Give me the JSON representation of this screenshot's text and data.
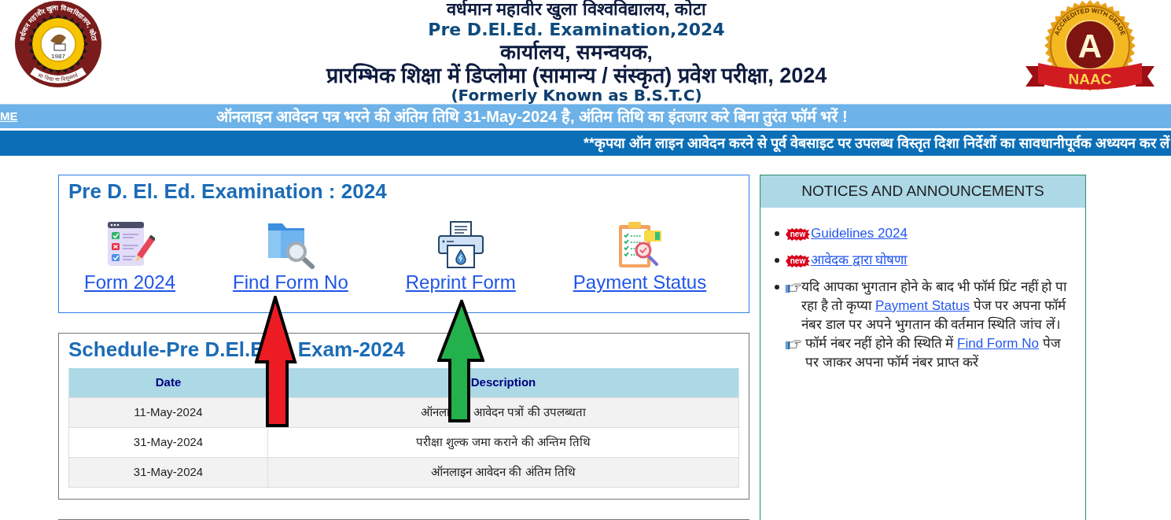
{
  "header": {
    "logo": {
      "ring_text": "वर्धमान महावीर खुला विश्वविद्यालय, कोटा",
      "year": "1987",
      "motto": "सा विद्या या विमुक्तये"
    },
    "title_lines": [
      {
        "kind": "university",
        "text": "वर्धमान महावीर खुला विश्वविद्यालय, कोटा"
      },
      {
        "kind": "exam",
        "text": "Pre D.El.Ed. Examination,2024"
      },
      {
        "kind": "office",
        "text": "कार्यालय, समन्वयक,"
      },
      {
        "kind": "course",
        "text": "प्रारम्भिक शिक्षा में डिप्लोमा (सामान्य / संस्कृत) प्रवेश परीक्षा, 2024"
      },
      {
        "kind": "former_name",
        "text": "(Formerly Known as B.S.T.C)"
      }
    ],
    "badge": {
      "ring_text": "ACCREDITED WITH GRADE",
      "grade": "A",
      "ribbon": "NAAC"
    }
  },
  "ticker": {
    "link": "ME",
    "text": "ऑनलाइन आवेदन पत्र भरने की अंतिम तिथि 31-May-2024 है, अंतिम तिथि का इंतजार करे बिना तुरंत फॉर्म भरें !"
  },
  "notice_bar": {
    "text": "**कृपया ऑन लाइन आवेदन करने से पूर्व वेबसाइट पर उपलब्ध विस्तृत दिशा निर्देशों का सावधानीपूर्वक अध्ययन कर लें"
  },
  "exam_card": {
    "title": "Pre D. El. Ed. Examination : 2024",
    "links": [
      "Form 2024",
      "Find Form No",
      "Reprint Form",
      "Payment Status"
    ]
  },
  "schedule": {
    "title_parts": [
      "Schedule-Pre D.El.E",
      "Exam-2024"
    ],
    "columns": [
      "Date",
      "Description"
    ],
    "rows": [
      {
        "date": "11-May-2024",
        "description_parts": [
          "ऑनला",
          "आवेदन पत्रों की उपलब्धता"
        ]
      },
      {
        "date": "31-May-2024",
        "description_parts": [
          "परीक्षा शुल्क जमा कराने की अन्तिम तिथि"
        ]
      },
      {
        "date": "31-May-2024",
        "description_parts": [
          "ऑनलाइन आवेदन की अंतिम तिथि"
        ]
      }
    ]
  },
  "notices": {
    "title": "NOTICES AND ANNOUNCEMENTS",
    "items": [
      {
        "kind": "new_link",
        "badge": "new",
        "link": "Guidelines 2024"
      },
      {
        "kind": "new_link",
        "badge": "new",
        "link": "आवेदक द्वारा घोषणा"
      },
      {
        "kind": "pointer_text",
        "paragraphs": [
          [
            {
              "text": "यदि आपका भुगतान होने के बाद भी फॉर्म प्रिंट नहीं हो पा रहा है तो कृप्या "
            },
            {
              "link": "Payment Status"
            },
            {
              "text": " पेज पर अपना फॉर्म नंबर डाल पर अपने भुगतान की वर्तमान स्थिति जांच लें।"
            }
          ],
          [
            {
              "text": "फॉर्म नंबर नहीं होने की स्थिति में "
            },
            {
              "link": "Find Form No"
            },
            {
              "text": " पेज पर जाकर अपना फॉर्म नंबर प्राप्त करें"
            }
          ]
        ]
      }
    ]
  },
  "arrows": [
    {
      "color": "#ed1c24"
    },
    {
      "color": "#22b14c"
    }
  ]
}
